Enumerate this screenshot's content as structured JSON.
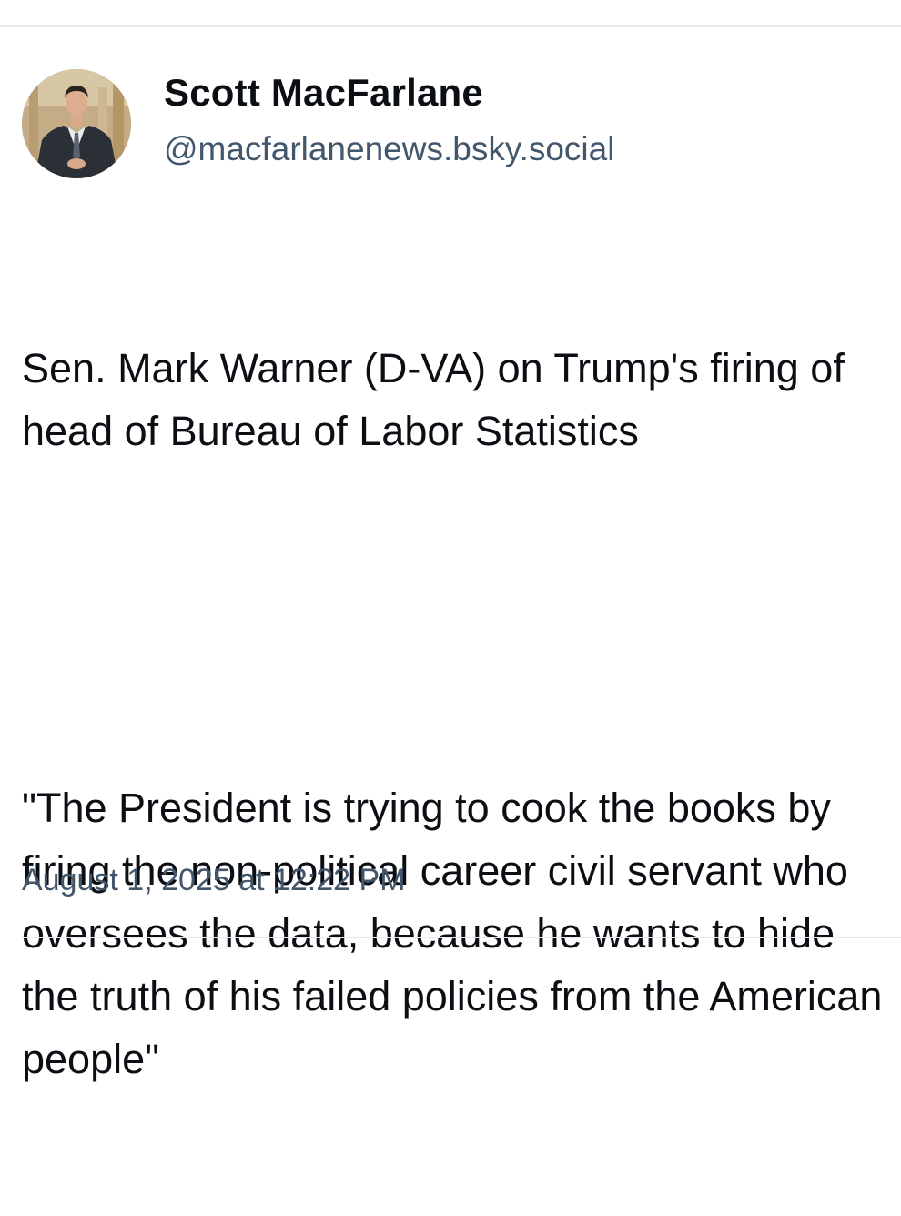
{
  "post": {
    "author": {
      "display_name": "Scott MacFarlane",
      "handle": "@macfarlanenews.bsky.social",
      "avatar_icon": "user-avatar-photo"
    },
    "text": {
      "paragraph_1": "Sen. Mark Warner (D-VA) on Trump's firing of head of Bureau of Labor Statistics",
      "paragraph_2": "\"The President is trying to cook the books by firing the non-political career civil servant who oversees the data, because he wants to hide the truth of his failed policies from the American people\""
    },
    "timestamp": "August 1, 2025 at 12:22 PM"
  },
  "colors": {
    "text_primary": "#0b0f14",
    "text_secondary": "#42576c",
    "divider": "#e6e9ee",
    "background": "#ffffff"
  }
}
